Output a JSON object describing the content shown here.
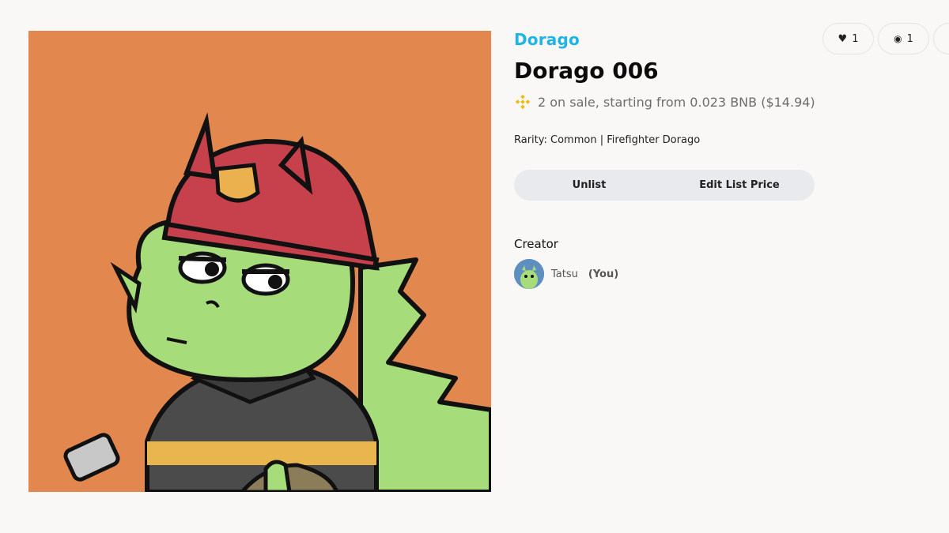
{
  "collection": "Dorago",
  "title": "Dorago 006",
  "sale": {
    "text": "2 on sale, starting from 0.023 BNB ($14.94)",
    "icon": "bnb-icon"
  },
  "rarity": "Rarity: Common | Firefighter Dorago",
  "actions": {
    "unlist": "Unlist",
    "edit_price": "Edit List Price"
  },
  "creator": {
    "label": "Creator",
    "name": "Tatsu",
    "you": "(You)"
  },
  "stats": {
    "likes": "1",
    "views": "1"
  },
  "colors": {
    "accent": "#1fb4e6",
    "art_bg": "#e2884f",
    "bnb": "#f0b90b"
  }
}
